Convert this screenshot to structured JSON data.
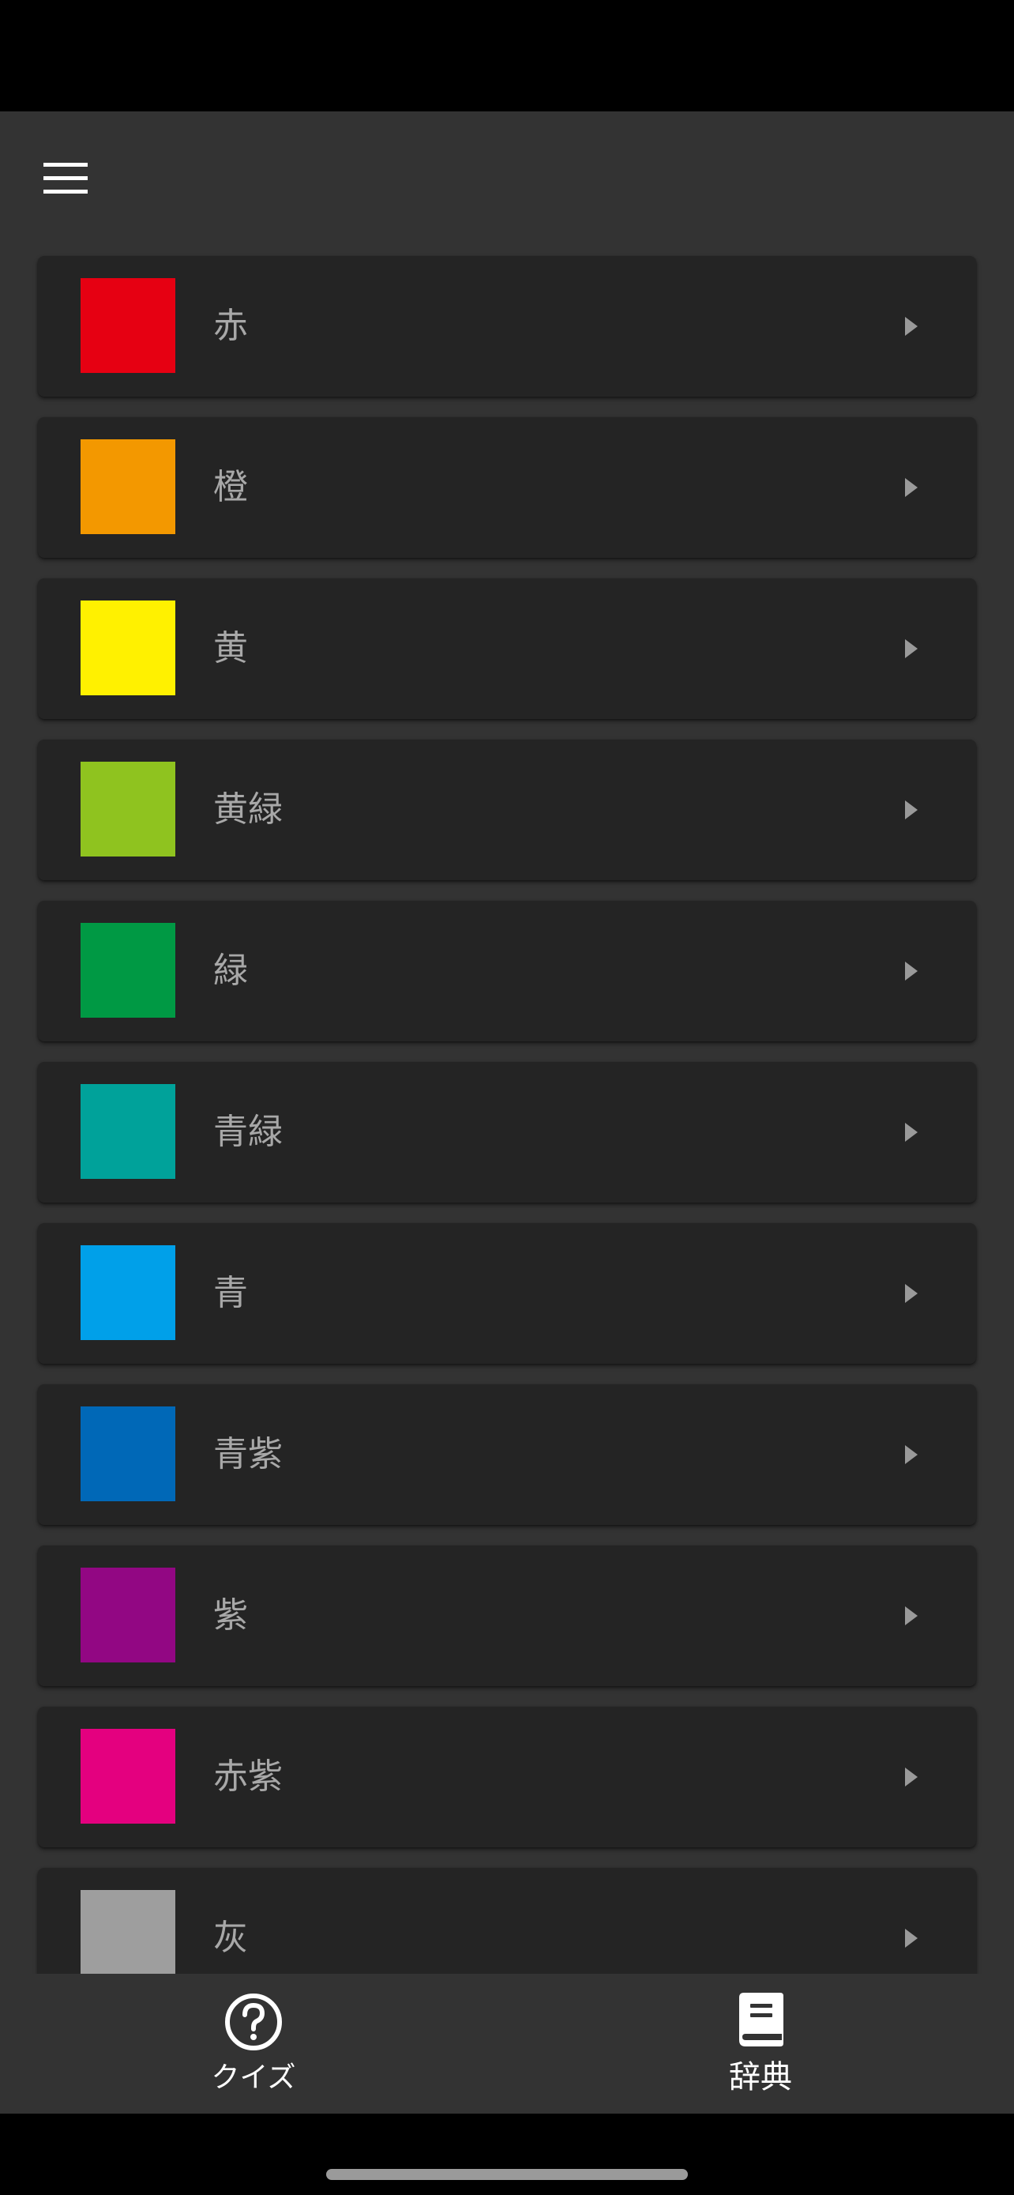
{
  "app_bar": {
    "menu_icon": "hamburger-menu-icon"
  },
  "colors": [
    {
      "label": "赤",
      "swatch": "#E60012"
    },
    {
      "label": "橙",
      "swatch": "#F39800"
    },
    {
      "label": "黄",
      "swatch": "#FFF100"
    },
    {
      "label": "黄緑",
      "swatch": "#8FC31F"
    },
    {
      "label": "緑",
      "swatch": "#009944"
    },
    {
      "label": "青緑",
      "swatch": "#00A29A"
    },
    {
      "label": "青",
      "swatch": "#00A0E9"
    },
    {
      "label": "青紫",
      "swatch": "#0068B7"
    },
    {
      "label": "紫",
      "swatch": "#920783"
    },
    {
      "label": "赤紫",
      "swatch": "#E4007F"
    },
    {
      "label": "灰",
      "swatch": "#9E9E9E"
    }
  ],
  "bottom_nav": {
    "items": [
      {
        "label": "クイズ",
        "icon": "help-circle-icon",
        "active": false
      },
      {
        "label": "辞典",
        "icon": "book-icon",
        "active": true
      }
    ]
  },
  "theme": {
    "background": "#333333",
    "card": "#242424",
    "label_text": "#A8A8A8",
    "nav_text": "#FFFFFF"
  }
}
